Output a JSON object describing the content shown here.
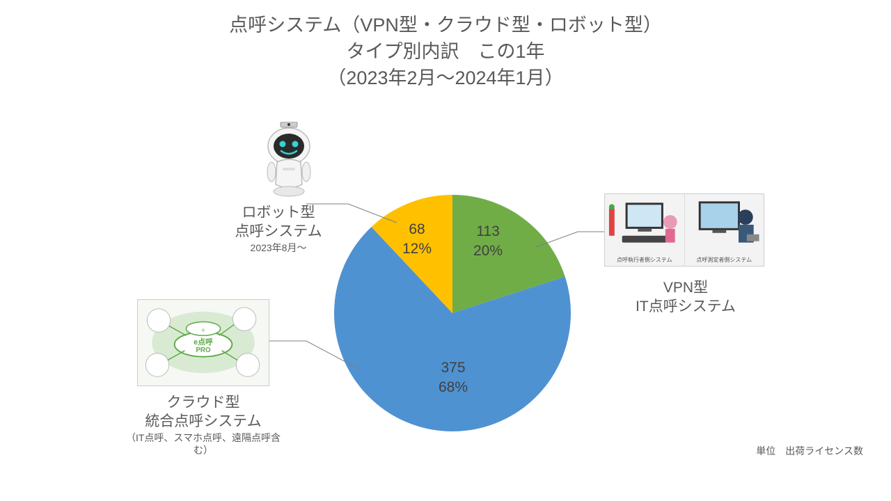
{
  "title_line1": "点呼システム（VPN型・クラウド型・ロボット型）",
  "title_line2": "タイプ別内訳　この1年",
  "title_line3": "（2023年2月～2024年1月）",
  "unit_label": "単位　出荷ライセンス数",
  "labels": {
    "vpn_value": "113",
    "vpn_percent": "20%",
    "cloud_value": "375",
    "cloud_percent": "68%",
    "robot_value": "68",
    "robot_percent": "12%"
  },
  "annotations": {
    "vpn_line1": "VPN型",
    "vpn_line2": "IT点呼システム",
    "cloud_line1": "クラウド型",
    "cloud_line2": "統合点呼システム",
    "cloud_line3": "（IT点呼、スマホ点呼、遠隔点呼含む）",
    "robot_line1": "ロボット型",
    "robot_line2": "点呼システム",
    "robot_line3": "2023年8月～",
    "photo_caption_left": "点呼執行者側システム",
    "photo_caption_right": "点呼測定者側システム"
  },
  "colors": {
    "vpn": "#70ad47",
    "cloud": "#4f92d2",
    "robot": "#ffc000"
  },
  "chart_data": {
    "type": "pie",
    "title": "点呼システム（VPN型・クラウド型・ロボット型）タイプ別内訳　この1年（2023年2月～2024年1月）",
    "categories": [
      "VPN型 IT点呼システム",
      "クラウド型 統合点呼システム（IT点呼、スマホ点呼、遠隔点呼含む）",
      "ロボット型 点呼システム 2023年8月～"
    ],
    "values": [
      113,
      375,
      68
    ],
    "percents": [
      20,
      68,
      12
    ],
    "unit": "出荷ライセンス数",
    "period": "2023年2月～2024年1月"
  }
}
